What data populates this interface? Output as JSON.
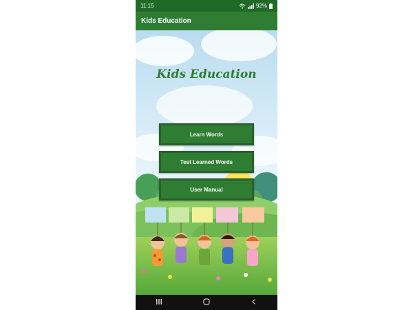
{
  "status_bar": {
    "time": "11:15",
    "battery": "92%"
  },
  "app_bar": {
    "title": "Kids Education"
  },
  "main": {
    "heading": "Kids Education",
    "buttons": [
      "Learn Words",
      "Test Learned Words",
      "User Manual"
    ]
  },
  "colors": {
    "primary": "#2e7d32",
    "status_bar": "#1f6a27",
    "button_border": "#2b5f2e"
  },
  "icons": {
    "nav_recents": "recents-icon",
    "nav_home": "home-icon",
    "nav_back": "back-icon"
  }
}
